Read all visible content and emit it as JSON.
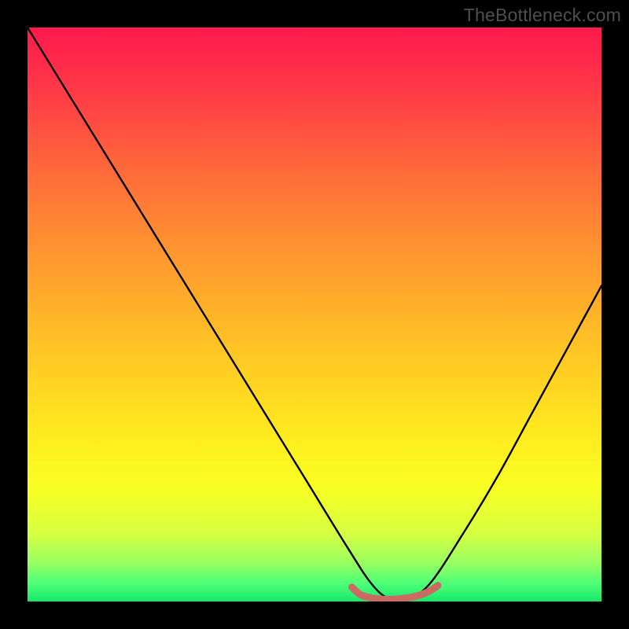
{
  "watermark": "TheBottleneck.com",
  "chart_data": {
    "type": "line",
    "title": "",
    "xlabel": "",
    "ylabel": "",
    "xlim": [
      0,
      100
    ],
    "ylim": [
      0,
      100
    ],
    "grid": false,
    "legend": false,
    "series": [
      {
        "name": "bottleneck-curve",
        "x": [
          0,
          8,
          16,
          24,
          32,
          40,
          48,
          56,
          60,
          63,
          66,
          70,
          76,
          82,
          88,
          94,
          100
        ],
        "y": [
          100,
          87,
          74,
          61,
          48,
          35,
          22,
          9,
          3,
          0.5,
          0.5,
          3,
          12,
          22,
          33,
          44,
          55
        ]
      },
      {
        "name": "optimal-zone",
        "x": [
          56.5,
          58,
          60,
          62,
          64,
          66,
          68,
          70,
          71.5
        ],
        "y": [
          2.5,
          1.2,
          0.6,
          0.4,
          0.4,
          0.6,
          1.0,
          1.8,
          2.8
        ]
      }
    ],
    "colors": {
      "curve": "#000000",
      "optimal_zone": "#cb6a62",
      "gradient_top": "#ff1a4d",
      "gradient_bottom": "#17e76a"
    }
  }
}
